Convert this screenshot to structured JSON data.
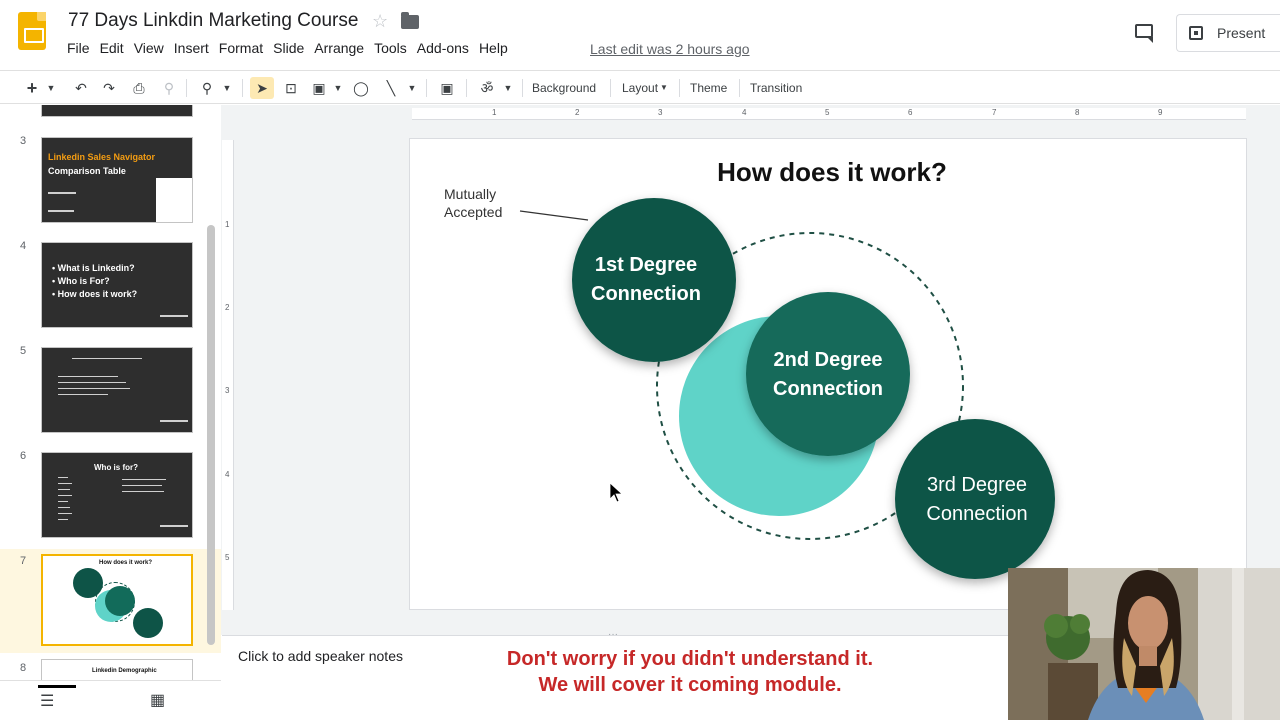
{
  "app": {
    "doc_title": "77 Days Linkdin Marketing Course",
    "menu": [
      "File",
      "Edit",
      "View",
      "Insert",
      "Format",
      "Slide",
      "Arrange",
      "Tools",
      "Add-ons",
      "Help"
    ],
    "last_edit": "Last edit was 2 hours ago",
    "present_label": "Present"
  },
  "toolbar": {
    "new_symbol": "+",
    "background": "Background",
    "layout": "Layout",
    "theme": "Theme",
    "transition": "Transition"
  },
  "ruler": {
    "h_ticks": [
      "1",
      "2",
      "3",
      "4",
      "5",
      "6",
      "7",
      "8",
      "9"
    ],
    "v_ticks": [
      "1",
      "2",
      "3",
      "4",
      "5"
    ]
  },
  "filmstrip": {
    "slides": [
      {
        "number": "3",
        "title_line1": "Linkedin Sales Navigator",
        "title_line2": "Comparison Table"
      },
      {
        "number": "4",
        "bullets": [
          "What is Linkedin?",
          "Who is For?",
          "How does it work?"
        ]
      },
      {
        "number": "5"
      },
      {
        "number": "6",
        "title": "Who is for?"
      },
      {
        "number": "7",
        "title": "How does it work?"
      },
      {
        "number": "8",
        "title": "Linkedin Demographic"
      }
    ]
  },
  "slide": {
    "title": "How does it work?",
    "annotation_line1": "Mutually",
    "annotation_line2": "Accepted",
    "nodes": [
      {
        "line1": "1st Degree",
        "line2": "Connection"
      },
      {
        "line1": "2nd Degree",
        "line2": "Connection"
      },
      {
        "line1": "3rd Degree",
        "line2": "Connection"
      }
    ]
  },
  "notes": {
    "placeholder": "Click to add speaker notes"
  },
  "caption": {
    "line1": "Don't worry if you didn't understand it.",
    "line2": "We will cover it coming module."
  },
  "colors": {
    "node_dark": "#0e5447",
    "ring_teal": "#5fd3c8",
    "caption_red": "#c62828",
    "accent_yellow": "#f4b400"
  }
}
